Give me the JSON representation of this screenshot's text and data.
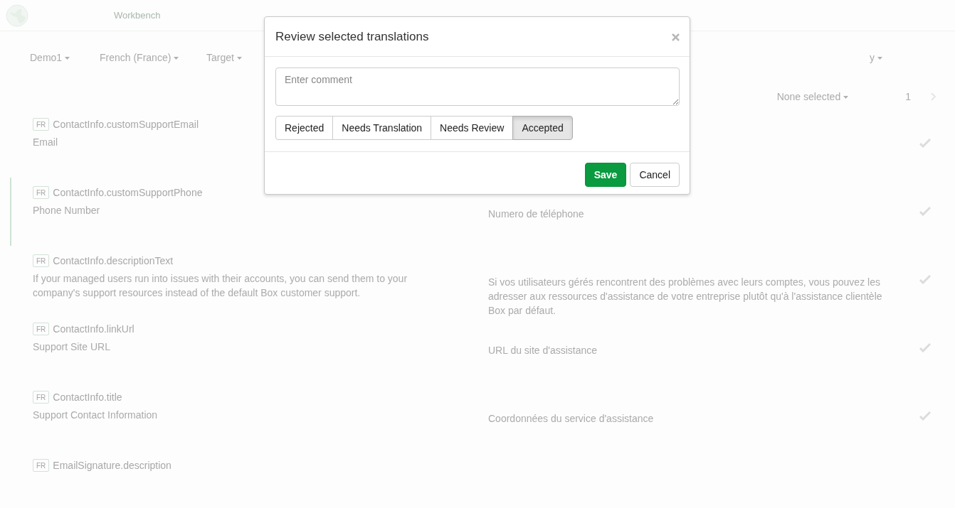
{
  "header": {
    "title": "Workbench"
  },
  "filters": [
    {
      "label": "Demo1"
    },
    {
      "label": "French (France)"
    },
    {
      "label": "Target"
    },
    {
      "label": "y"
    }
  ],
  "pagination": {
    "selection": "None selected",
    "page": "1"
  },
  "rows": [
    {
      "badge": "FR",
      "key": "ContactInfo.customSupportEmail",
      "source": "Email",
      "active": false
    },
    {
      "badge": "FR",
      "key": "ContactInfo.customSupportPhone",
      "source": "Phone Number",
      "target": "Numero de téléphone",
      "active": true
    },
    {
      "badge": "FR",
      "key": "ContactInfo.descriptionText",
      "source": "If your managed users run into issues with their accounts, you can send them to your company's support resources instead of the default Box customer support.",
      "target": "Si vos utilisateurs gérés rencontrent des problèmes avec leurs comptes, vous pouvez les adresser aux ressources d'assistance de votre entreprise plutôt qu'à l'assistance clientèle Box par défaut.",
      "active": false
    },
    {
      "badge": "FR",
      "key": "ContactInfo.linkUrl",
      "source": "Support Site URL",
      "target": "URL du site d'assistance",
      "active": false
    },
    {
      "badge": "FR",
      "key": "ContactInfo.title",
      "source": "Support Contact Information",
      "target": "Coordonnées du service d'assistance",
      "active": false
    },
    {
      "badge": "FR",
      "key": "EmailSignature.description",
      "active": false
    }
  ],
  "modal": {
    "title": "Review selected translations",
    "comment": {
      "placeholder": "Enter comment"
    },
    "statuses": [
      {
        "label": "Rejected",
        "selected": false
      },
      {
        "label": "Needs Translation",
        "selected": false
      },
      {
        "label": "Needs Review",
        "selected": false
      },
      {
        "label": "Accepted",
        "selected": true
      }
    ],
    "buttons": [
      {
        "label": "Save",
        "kind": "primary"
      },
      {
        "label": "Cancel",
        "kind": "default"
      }
    ]
  }
}
